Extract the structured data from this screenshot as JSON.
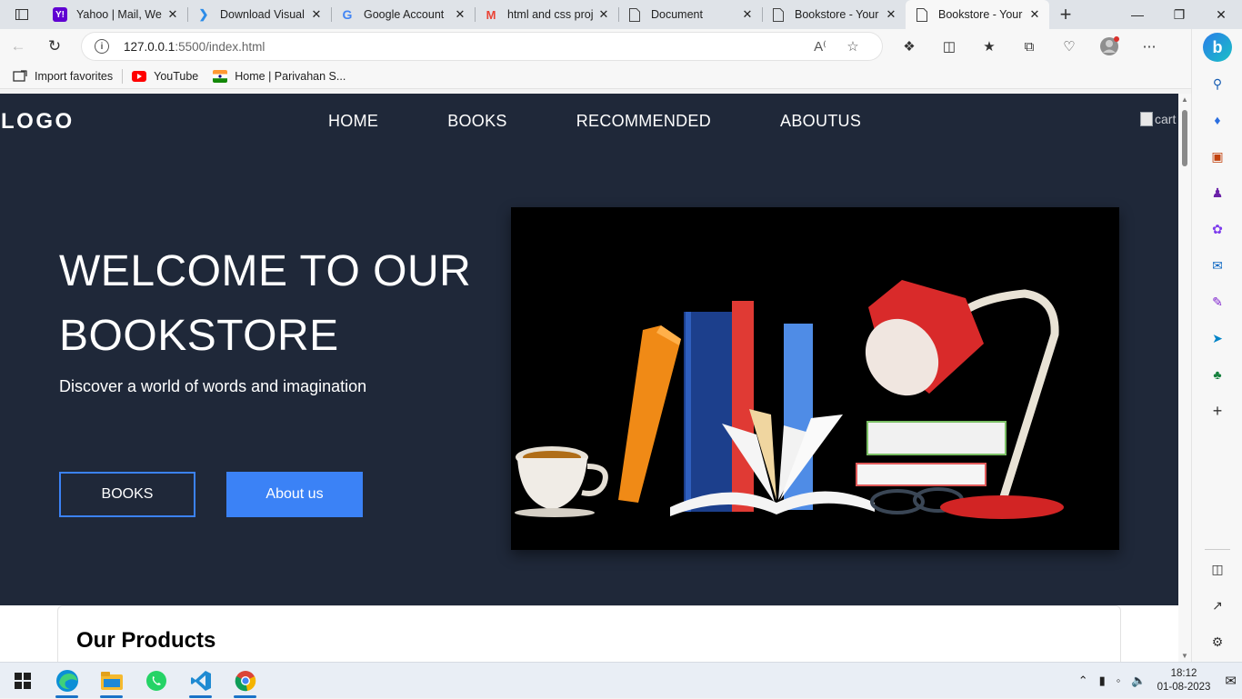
{
  "browser": {
    "tabs": [
      {
        "title": "Yahoo | Mail, Weather",
        "icon": "yahoo-icon",
        "color": "#6001d2"
      },
      {
        "title": "Download Visual Studio Code",
        "icon": "vscode-icon",
        "color": "#2c8ce8"
      },
      {
        "title": "Google Account",
        "icon": "google-icon",
        "color": "#4285f4"
      },
      {
        "title": "html and css projects",
        "icon": "gmail-icon",
        "color": "#ea4335"
      },
      {
        "title": "Document",
        "icon": "page-icon",
        "color": "#555555"
      },
      {
        "title": "Bookstore - Your",
        "icon": "page-icon",
        "color": "#555555"
      },
      {
        "title": "Bookstore - Your",
        "icon": "page-icon",
        "color": "#555555"
      }
    ],
    "address": {
      "host": "127.0.0.1",
      "path": ":5500/index.html"
    },
    "favorites": [
      {
        "label": "Import favorites",
        "icon": "import-icon"
      },
      {
        "label": "YouTube",
        "icon": "youtube-icon",
        "color": "#ff0000"
      },
      {
        "label": "Home | Parivahan S...",
        "icon": "india-flag-icon"
      }
    ]
  },
  "page": {
    "logo": "LOGO",
    "nav": [
      "HOME",
      "BOOKS",
      "RECOMMENDED",
      "ABOUTUS"
    ],
    "cart_alt": "cart",
    "hero": {
      "headline_line1": "WELCOME TO OUR",
      "headline_line2": "BOOKSTORE",
      "subtitle": "Discover a world of words and imagination",
      "btn_books": "BOOKS",
      "btn_about": "About us"
    },
    "products_heading": "Our Products",
    "colors": {
      "hero_bg": "#1f2839",
      "accent": "#3b82f6"
    }
  },
  "taskbar": {
    "time": "18:12",
    "date": "01-08-2023"
  }
}
